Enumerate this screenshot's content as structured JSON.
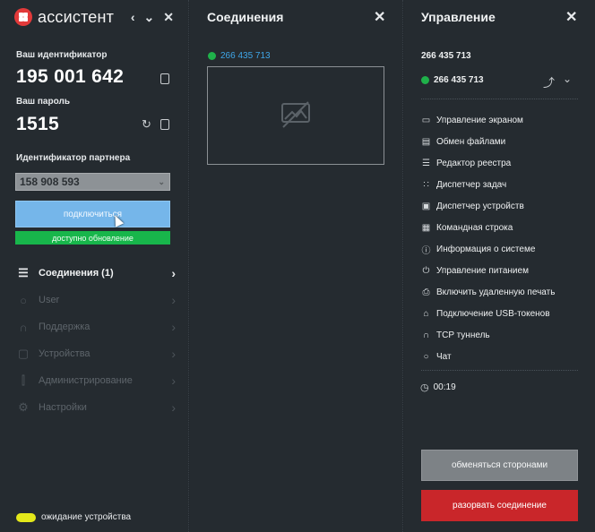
{
  "app": {
    "logo_text": "ассистент"
  },
  "left": {
    "id_label": "Ваш идентификатор",
    "id_value": "195 001 642",
    "password_label": "Ваш пароль",
    "password_value": "1515",
    "partner_label": "Идентификатор партнера",
    "partner_value": "158 908 593",
    "connect_button": "подключиться",
    "update_text": "доступно обновление",
    "nav": [
      {
        "label": "Соединения (1)",
        "icon": "connections-icon"
      },
      {
        "label": "User",
        "icon": "user-icon"
      },
      {
        "label": "Поддержка",
        "icon": "headset-icon"
      },
      {
        "label": "Устройства",
        "icon": "devices-icon"
      },
      {
        "label": "Администрирование",
        "icon": "sliders-icon"
      },
      {
        "label": "Настройки",
        "icon": "gears-icon"
      }
    ],
    "status_text": "ожидание устройства",
    "status_color": "#e4e81a"
  },
  "middle": {
    "title": "Соединения",
    "connection_id": "266 435 713"
  },
  "right": {
    "title": "Управление",
    "connection_id": "266 435 713",
    "active_connection": "266 435 713",
    "actions": [
      {
        "label": "Управление экраном",
        "icon": "monitor-icon"
      },
      {
        "label": "Обмен файлами",
        "icon": "folder-icon"
      },
      {
        "label": "Редактор реестра",
        "icon": "registry-icon"
      },
      {
        "label": "Диспетчер задач",
        "icon": "tasks-icon"
      },
      {
        "label": "Диспетчер устройств",
        "icon": "device-manager-icon"
      },
      {
        "label": "Командная строка",
        "icon": "terminal-icon"
      },
      {
        "label": "Информация о системе",
        "icon": "info-icon"
      },
      {
        "label": "Управление питанием",
        "icon": "power-icon"
      },
      {
        "label": "Включить удаленную печать",
        "icon": "printer-icon"
      },
      {
        "label": "Подключение USB-токенов",
        "icon": "usb-token-icon"
      },
      {
        "label": "TCP туннель",
        "icon": "tunnel-icon"
      },
      {
        "label": "Чат",
        "icon": "chat-icon"
      }
    ],
    "timer": "00:19",
    "swap_button": "обменяться сторонами",
    "disconnect_button": "разорвать соединение"
  },
  "colors": {
    "accent_blue": "#75b6ea",
    "update_green": "#18b64b",
    "online_green": "#1fb14a",
    "danger_red": "#c9262a"
  }
}
